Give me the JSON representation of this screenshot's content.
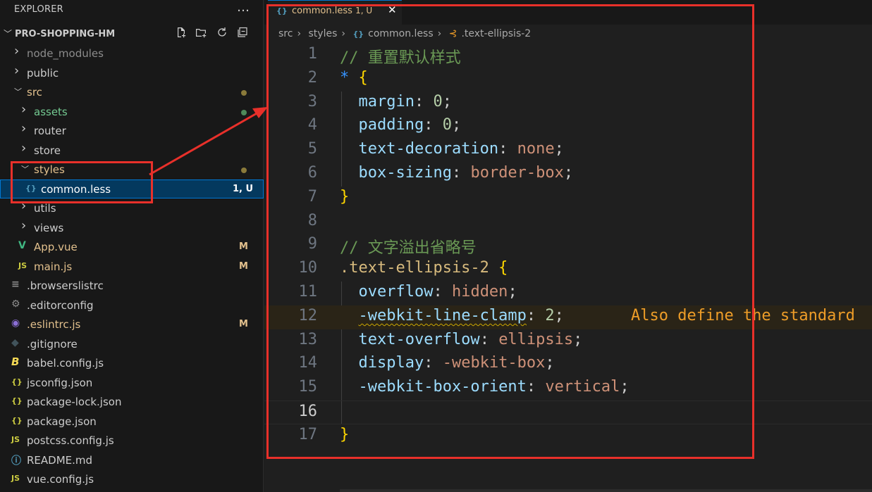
{
  "sidebar": {
    "title": "EXPLORER",
    "more_icon": "…",
    "project": "PRO-SHOPPING-HM",
    "actions": [
      "new-file-icon",
      "new-folder-icon",
      "refresh-icon",
      "collapse-all-icon"
    ],
    "items": [
      {
        "label": "node_modules",
        "type": "folder",
        "open": false,
        "indent": 0,
        "color": "#8c8c8c"
      },
      {
        "label": "public",
        "type": "folder",
        "open": false,
        "indent": 0,
        "color": "#cccccc"
      },
      {
        "label": "src",
        "type": "folder",
        "open": true,
        "indent": 0,
        "color": "#e2c08d",
        "dot": "#8a7a3a"
      },
      {
        "label": "assets",
        "type": "folder",
        "open": false,
        "indent": 1,
        "color": "#73c991",
        "dot": "#4d8a5a"
      },
      {
        "label": "router",
        "type": "folder",
        "open": false,
        "indent": 1,
        "color": "#cccccc"
      },
      {
        "label": "store",
        "type": "folder",
        "open": false,
        "indent": 1,
        "color": "#cccccc"
      },
      {
        "label": "styles",
        "type": "folder",
        "open": true,
        "indent": 1,
        "color": "#e2c08d",
        "dot": "#8a7a3a"
      },
      {
        "label": "common.less",
        "type": "file",
        "icon": "{}",
        "iconColor": "#519aba",
        "indent": 2,
        "color": "#ffffff",
        "badge": "1, U",
        "badgeColor": "#ffffff",
        "selected": true
      },
      {
        "label": "utils",
        "type": "folder",
        "open": false,
        "indent": 1,
        "color": "#cccccc"
      },
      {
        "label": "views",
        "type": "folder",
        "open": false,
        "indent": 1,
        "color": "#cccccc"
      },
      {
        "label": "App.vue",
        "type": "file",
        "icon": "V",
        "iconColor": "#41b883",
        "indent": 1,
        "color": "#e2c08d",
        "badge": "M",
        "badgeColor": "#e2c08d"
      },
      {
        "label": "main.js",
        "type": "file",
        "icon": "JS",
        "iconColor": "#cbcb41",
        "indent": 1,
        "color": "#e2c08d",
        "badge": "M",
        "badgeColor": "#e2c08d"
      },
      {
        "label": ".browserslistrc",
        "type": "file",
        "icon": "≡",
        "iconColor": "#8c8c8c",
        "indent": 0,
        "color": "#cccccc"
      },
      {
        "label": ".editorconfig",
        "type": "file",
        "icon": "⚙",
        "iconColor": "#8c8c8c",
        "indent": 0,
        "color": "#cccccc"
      },
      {
        "label": ".eslintrc.js",
        "type": "file",
        "icon": "◉",
        "iconColor": "#8b6fd6",
        "indent": 0,
        "color": "#e2c08d",
        "badge": "M",
        "badgeColor": "#e2c08d"
      },
      {
        "label": ".gitignore",
        "type": "file",
        "icon": "◆",
        "iconColor": "#41535b",
        "indent": 0,
        "color": "#cccccc"
      },
      {
        "label": "babel.config.js",
        "type": "file",
        "icon": "B",
        "iconColor": "#f5da55",
        "indent": 0,
        "color": "#cccccc"
      },
      {
        "label": "jsconfig.json",
        "type": "file",
        "icon": "{}",
        "iconColor": "#cbcb41",
        "indent": 0,
        "color": "#cccccc"
      },
      {
        "label": "package-lock.json",
        "type": "file",
        "icon": "{}",
        "iconColor": "#cbcb41",
        "indent": 0,
        "color": "#cccccc"
      },
      {
        "label": "package.json",
        "type": "file",
        "icon": "{}",
        "iconColor": "#cbcb41",
        "indent": 0,
        "color": "#cccccc"
      },
      {
        "label": "postcss.config.js",
        "type": "file",
        "icon": "JS",
        "iconColor": "#cbcb41",
        "indent": 0,
        "color": "#cccccc"
      },
      {
        "label": "README.md",
        "type": "file",
        "icon": "ⓘ",
        "iconColor": "#519aba",
        "indent": 0,
        "color": "#cccccc"
      },
      {
        "label": "vue.config.js",
        "type": "file",
        "icon": "JS",
        "iconColor": "#cbcb41",
        "indent": 0,
        "color": "#cccccc"
      }
    ]
  },
  "editor": {
    "tab": {
      "icon": "{}",
      "name": "common.less",
      "status": "1, U",
      "close": "✕"
    },
    "breadcrumb": [
      "src",
      "styles",
      "common.less",
      ".text-ellipsis-2"
    ],
    "lines": [
      [
        {
          "t": "// 重置默认样式",
          "c": "c-comment"
        }
      ],
      [
        {
          "t": "* ",
          "c": "c-star"
        },
        {
          "t": "{",
          "c": "c-brace"
        }
      ],
      [
        {
          "t": "  margin",
          "c": "c-prop"
        },
        {
          "t": ": ",
          "c": "c-punc"
        },
        {
          "t": "0",
          "c": "c-num"
        },
        {
          "t": ";",
          "c": "c-punc"
        }
      ],
      [
        {
          "t": "  padding",
          "c": "c-prop"
        },
        {
          "t": ": ",
          "c": "c-punc"
        },
        {
          "t": "0",
          "c": "c-num"
        },
        {
          "t": ";",
          "c": "c-punc"
        }
      ],
      [
        {
          "t": "  text-decoration",
          "c": "c-prop"
        },
        {
          "t": ": ",
          "c": "c-punc"
        },
        {
          "t": "none",
          "c": "c-val"
        },
        {
          "t": ";",
          "c": "c-punc"
        }
      ],
      [
        {
          "t": "  box-sizing",
          "c": "c-prop"
        },
        {
          "t": ": ",
          "c": "c-punc"
        },
        {
          "t": "border-box",
          "c": "c-val"
        },
        {
          "t": ";",
          "c": "c-punc"
        }
      ],
      [
        {
          "t": "}",
          "c": "c-brace"
        }
      ],
      [],
      [
        {
          "t": "// 文字溢出省略号",
          "c": "c-comment"
        }
      ],
      [
        {
          "t": ".text-ellipsis-2 ",
          "c": "c-sel"
        },
        {
          "t": "{",
          "c": "c-brace"
        }
      ],
      [
        {
          "t": "  overflow",
          "c": "c-prop"
        },
        {
          "t": ": ",
          "c": "c-punc"
        },
        {
          "t": "hidden",
          "c": "c-val"
        },
        {
          "t": ";",
          "c": "c-punc"
        }
      ],
      [
        {
          "t": "  ",
          "c": "c-prop"
        },
        {
          "t": "-webkit-line-clamp",
          "c": "c-prop squiggle"
        },
        {
          "t": ": ",
          "c": "c-punc"
        },
        {
          "t": "2",
          "c": "c-num"
        },
        {
          "t": ";",
          "c": "c-punc"
        }
      ],
      [
        {
          "t": "  text-overflow",
          "c": "c-prop"
        },
        {
          "t": ": ",
          "c": "c-punc"
        },
        {
          "t": "ellipsis",
          "c": "c-val"
        },
        {
          "t": ";",
          "c": "c-punc"
        }
      ],
      [
        {
          "t": "  display",
          "c": "c-prop"
        },
        {
          "t": ": ",
          "c": "c-punc"
        },
        {
          "t": "-webkit-box",
          "c": "c-val"
        },
        {
          "t": ";",
          "c": "c-punc"
        }
      ],
      [
        {
          "t": "  -webkit-box-orient",
          "c": "c-prop"
        },
        {
          "t": ": ",
          "c": "c-punc"
        },
        {
          "t": "vertical",
          "c": "c-val"
        },
        {
          "t": ";",
          "c": "c-punc"
        }
      ],
      [],
      [
        {
          "t": "}",
          "c": "c-brace"
        }
      ]
    ],
    "hint": "Also define the standard",
    "current_line": 16,
    "warning_line": 12
  }
}
